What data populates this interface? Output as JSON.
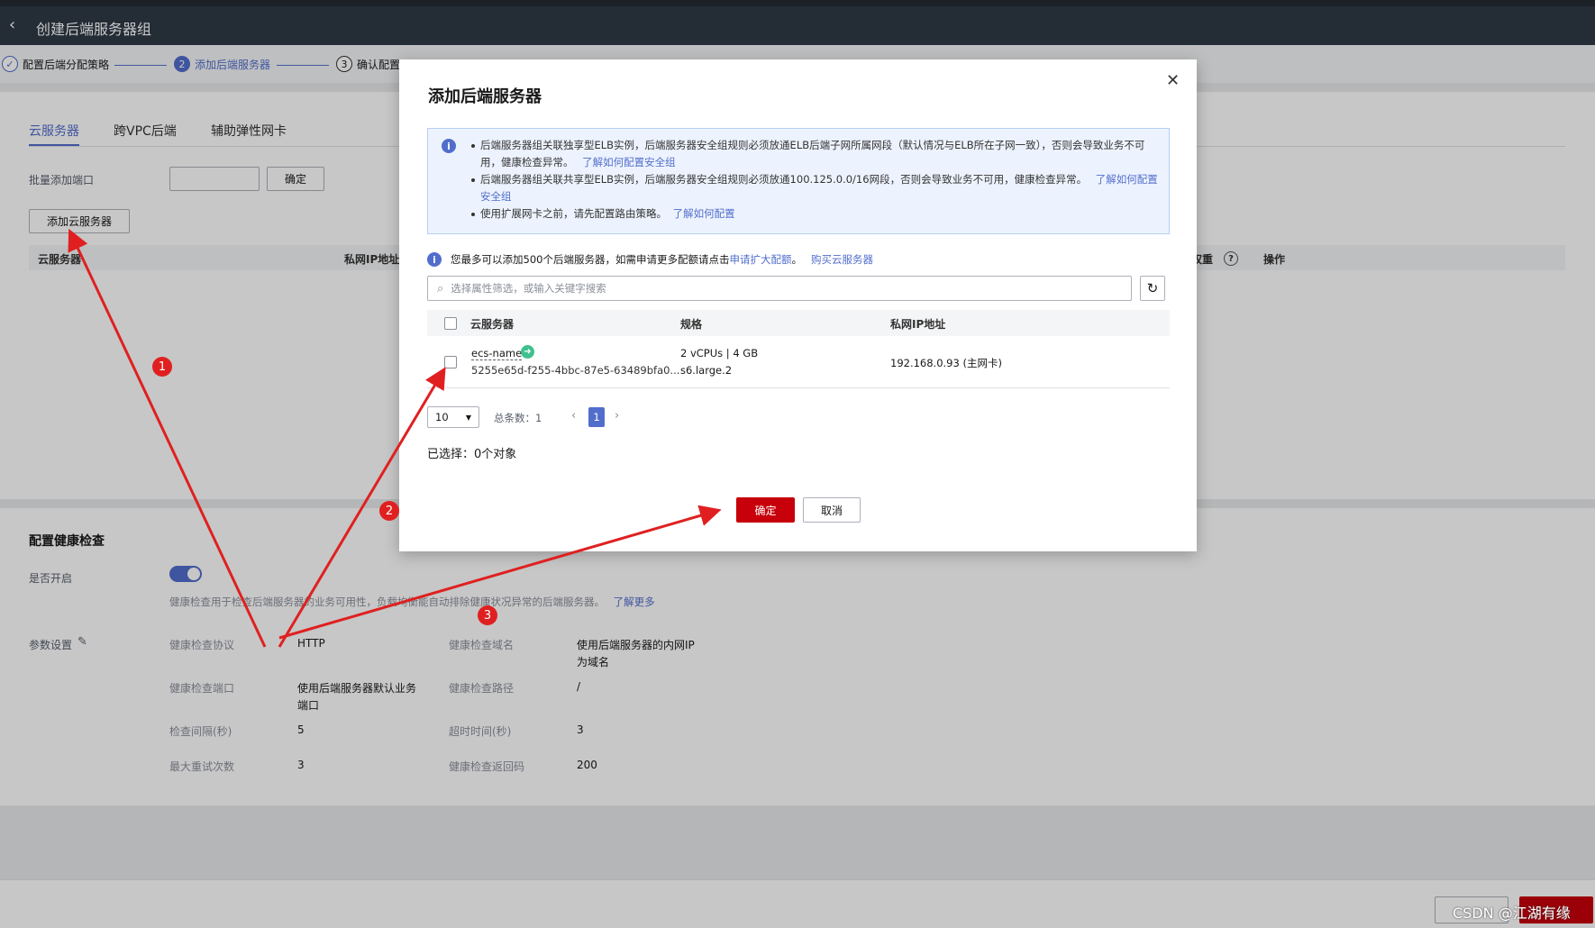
{
  "header": {
    "title": "创建后端服务器组"
  },
  "steps": [
    {
      "num": "✓",
      "label": "配置后端分配策略"
    },
    {
      "num": "2",
      "label": "添加后端服务器"
    },
    {
      "num": "3",
      "label": "确认配置"
    }
  ],
  "tabs": [
    "云服务器",
    "跨VPC后端",
    "辅助弹性网卡"
  ],
  "batch": {
    "label": "批量添加端口",
    "confirm": "确定"
  },
  "add_server_button": "添加云服务器",
  "bg_table": {
    "col_server": "云服务器",
    "col_ip": "私网IP地址",
    "col_weight": "权重",
    "col_ops": "操作"
  },
  "health": {
    "section_title": "配置健康检查",
    "enabled_label": "是否开启",
    "desc": "健康检查用于检查后端服务器的业务可用性，负载均衡能自动排除健康状况异常的后端服务器。",
    "learn_more": "了解更多",
    "params_label": "参数设置",
    "fields": [
      {
        "k": "健康检查协议",
        "v": "HTTP"
      },
      {
        "k": "健康检查域名",
        "v": "使用后端服务器的内网IP为域名"
      },
      {
        "k": "健康检查端口",
        "v": "使用后端服务器默认业务端口"
      },
      {
        "k": "健康检查路径",
        "v": "/"
      },
      {
        "k": "检查间隔(秒)",
        "v": "5"
      },
      {
        "k": "超时时间(秒)",
        "v": "3"
      },
      {
        "k": "最大重试次数",
        "v": "3"
      },
      {
        "k": "健康检查返回码",
        "v": "200"
      }
    ]
  },
  "modal": {
    "title": "添加后端服务器",
    "notice": {
      "item1": "后端服务器组关联独享型ELB实例，后端服务器安全组规则必须放通ELB后端子网所属网段（默认情况与ELB所在子网一致），否则会导致业务不可用，健康检查异常。",
      "item1_link": "了解如何配置安全组",
      "item2": "后端服务器组关联共享型ELB实例，后端服务器安全组规则必须放通100.125.0.0/16网段，否则会导致业务不可用，健康检查异常。",
      "item2_link": "了解如何配置安全组",
      "item3": "使用扩展网卡之前，请先配置路由策略。",
      "item3_link": "了解如何配置"
    },
    "quota_text": "您最多可以添加500个后端服务器，如需申请更多配额请点击",
    "quota_link": "申请扩大配额",
    "buy_link": "购买云服务器",
    "search_placeholder": "选择属性筛选，或输入关键字搜索",
    "table": {
      "headers": [
        "云服务器",
        "规格",
        "私网IP地址"
      ],
      "rows": [
        {
          "name": "ecs-name",
          "id": "5255e65d-f255-4bbc-87e5-63489bfa0...",
          "spec1": "2 vCPUs | 4 GB",
          "spec2": "s6.large.2",
          "ip": "192.168.0.93 (主网卡)"
        }
      ]
    },
    "page_size": "10",
    "total": "总条数：1",
    "current_page": "1",
    "selected": "已选择：0个对象",
    "ok": "确定",
    "cancel": "取消"
  },
  "annotations": [
    "1",
    "2",
    "3"
  ],
  "watermark": "CSDN @江湖有缘",
  "colors": {
    "accent": "#526ecc",
    "primary_button": "#c7000b",
    "header": "#2f3946",
    "annotation": "#e02020"
  }
}
